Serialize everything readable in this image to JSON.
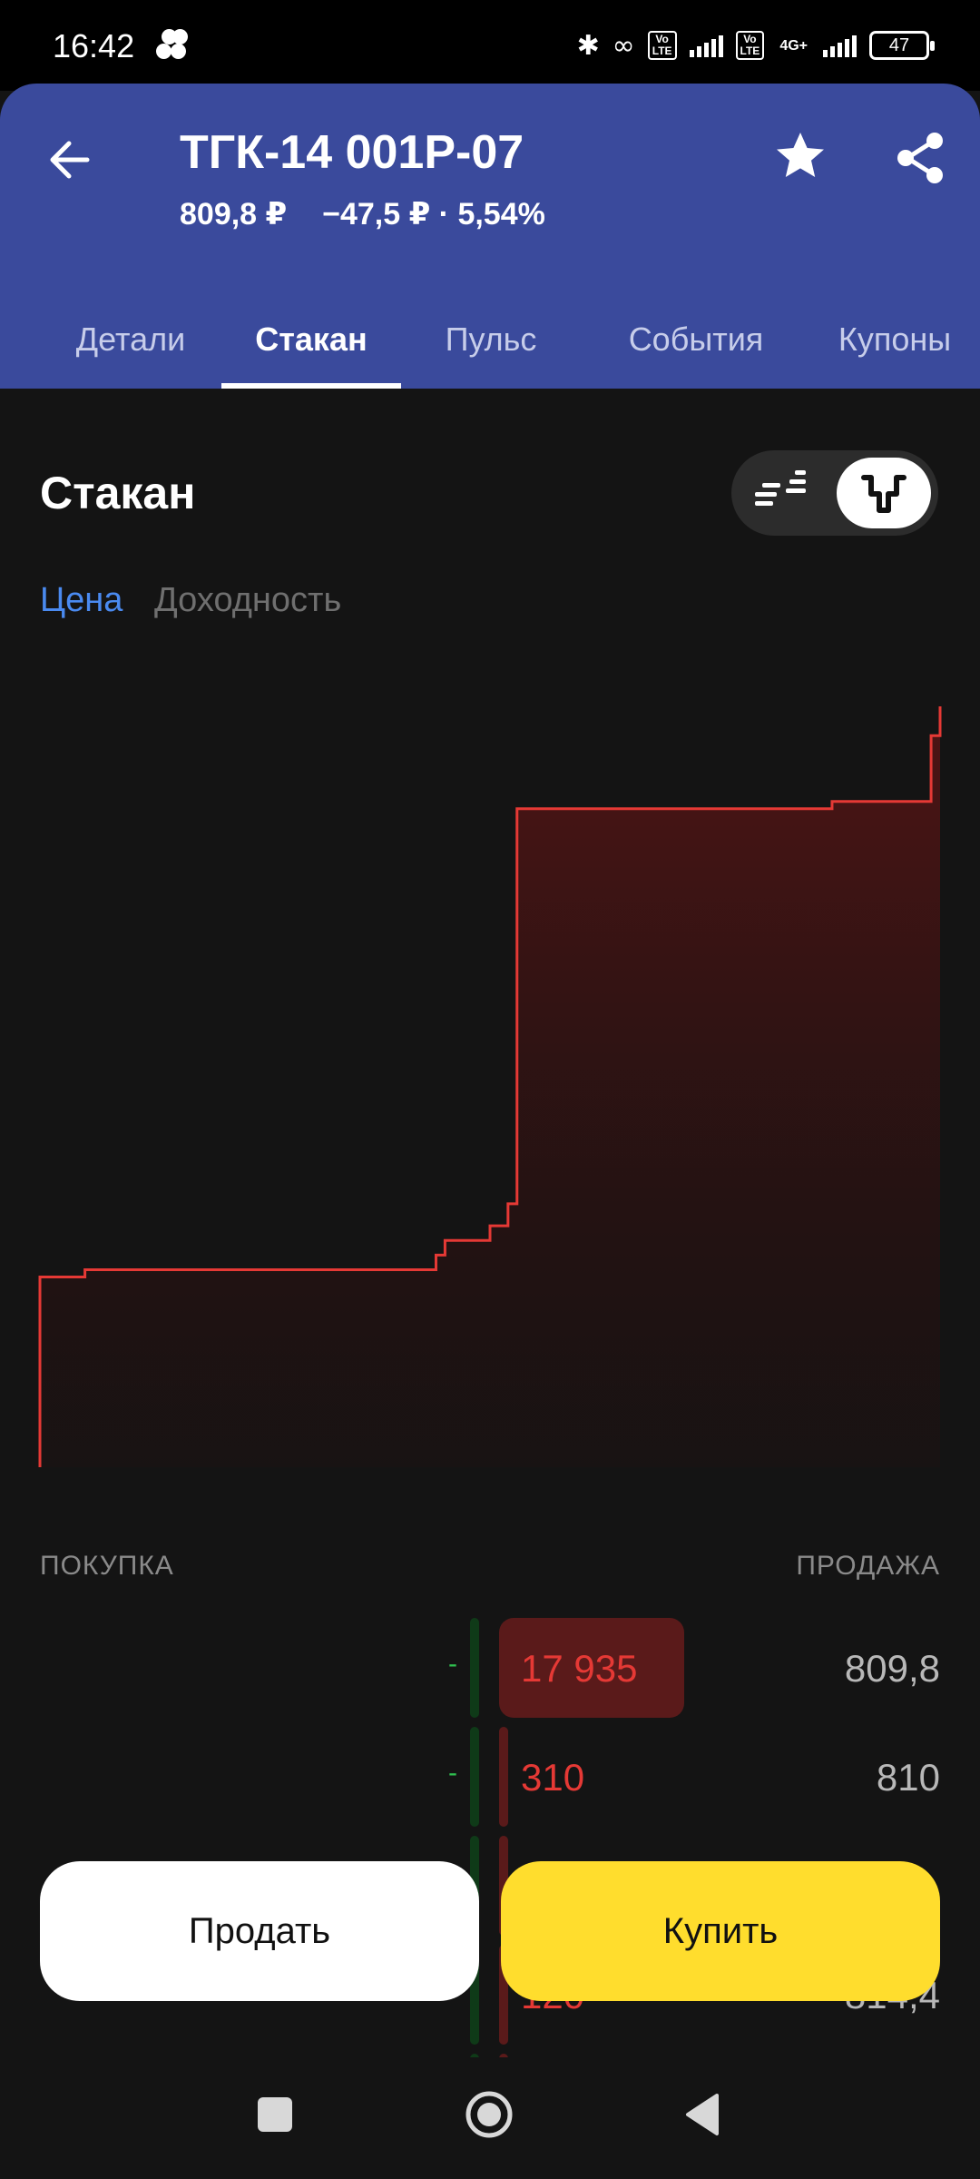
{
  "status_bar": {
    "time": "16:42",
    "battery": "47",
    "network": "4G+"
  },
  "header": {
    "title": "ТГК-14 001Р-07",
    "price": "809,8 ₽",
    "change": "−47,5 ₽ · 5,54%",
    "back_icon": "arrow-left-icon",
    "favorite_icon": "star-icon",
    "share_icon": "share-icon"
  },
  "tabs": [
    "Детали",
    "Стакан",
    "Пульс",
    "События",
    "Купоны"
  ],
  "active_tab": "Стакан",
  "section": {
    "title": "Стакан",
    "view_toggle": [
      "list-view-icon",
      "depth-chart-icon"
    ],
    "active_view": "depth-chart-icon",
    "filters": [
      "Цена",
      "Доходность"
    ],
    "active_filter": "Цена"
  },
  "colors": {
    "header_bg": "#3a4a9c",
    "ask_line": "#e53935",
    "bid_bar": "#2fbf4f",
    "buy_button": "#ffdd2d",
    "accent": "#4a8af0"
  },
  "orderbook": {
    "buy_label": "ПОКУПКА",
    "sell_label": "ПРОДАЖА",
    "rows": [
      {
        "bid": "-",
        "ask_qty": "17 935",
        "price": "809,8",
        "fill": 0.27
      },
      {
        "bid": "-",
        "ask_qty": "310",
        "price": "810",
        "fill": 0
      },
      {
        "bid": "-",
        "ask_qty": "",
        "price": "",
        "fill": 0
      },
      {
        "bid": "-",
        "ask_qty": "120",
        "price": "814,4",
        "fill": 0
      }
    ]
  },
  "actions": {
    "sell": "Продать",
    "buy": "Купить"
  },
  "chart_data": {
    "type": "area",
    "series": [
      {
        "side": "ask",
        "cumulative_volume": [
          2.6,
          2.7,
          2.9,
          2.9,
          3.1,
          3.3,
          3.6,
          9.0,
          9.1,
          10.0,
          10.4
        ]
      }
    ],
    "x_steps": [
      0,
      0.05,
      0.44,
      0.445,
      0.45,
      0.5,
      0.52,
      0.53,
      0.88,
      0.99,
      1.0
    ],
    "grid": false,
    "legend": "none"
  }
}
